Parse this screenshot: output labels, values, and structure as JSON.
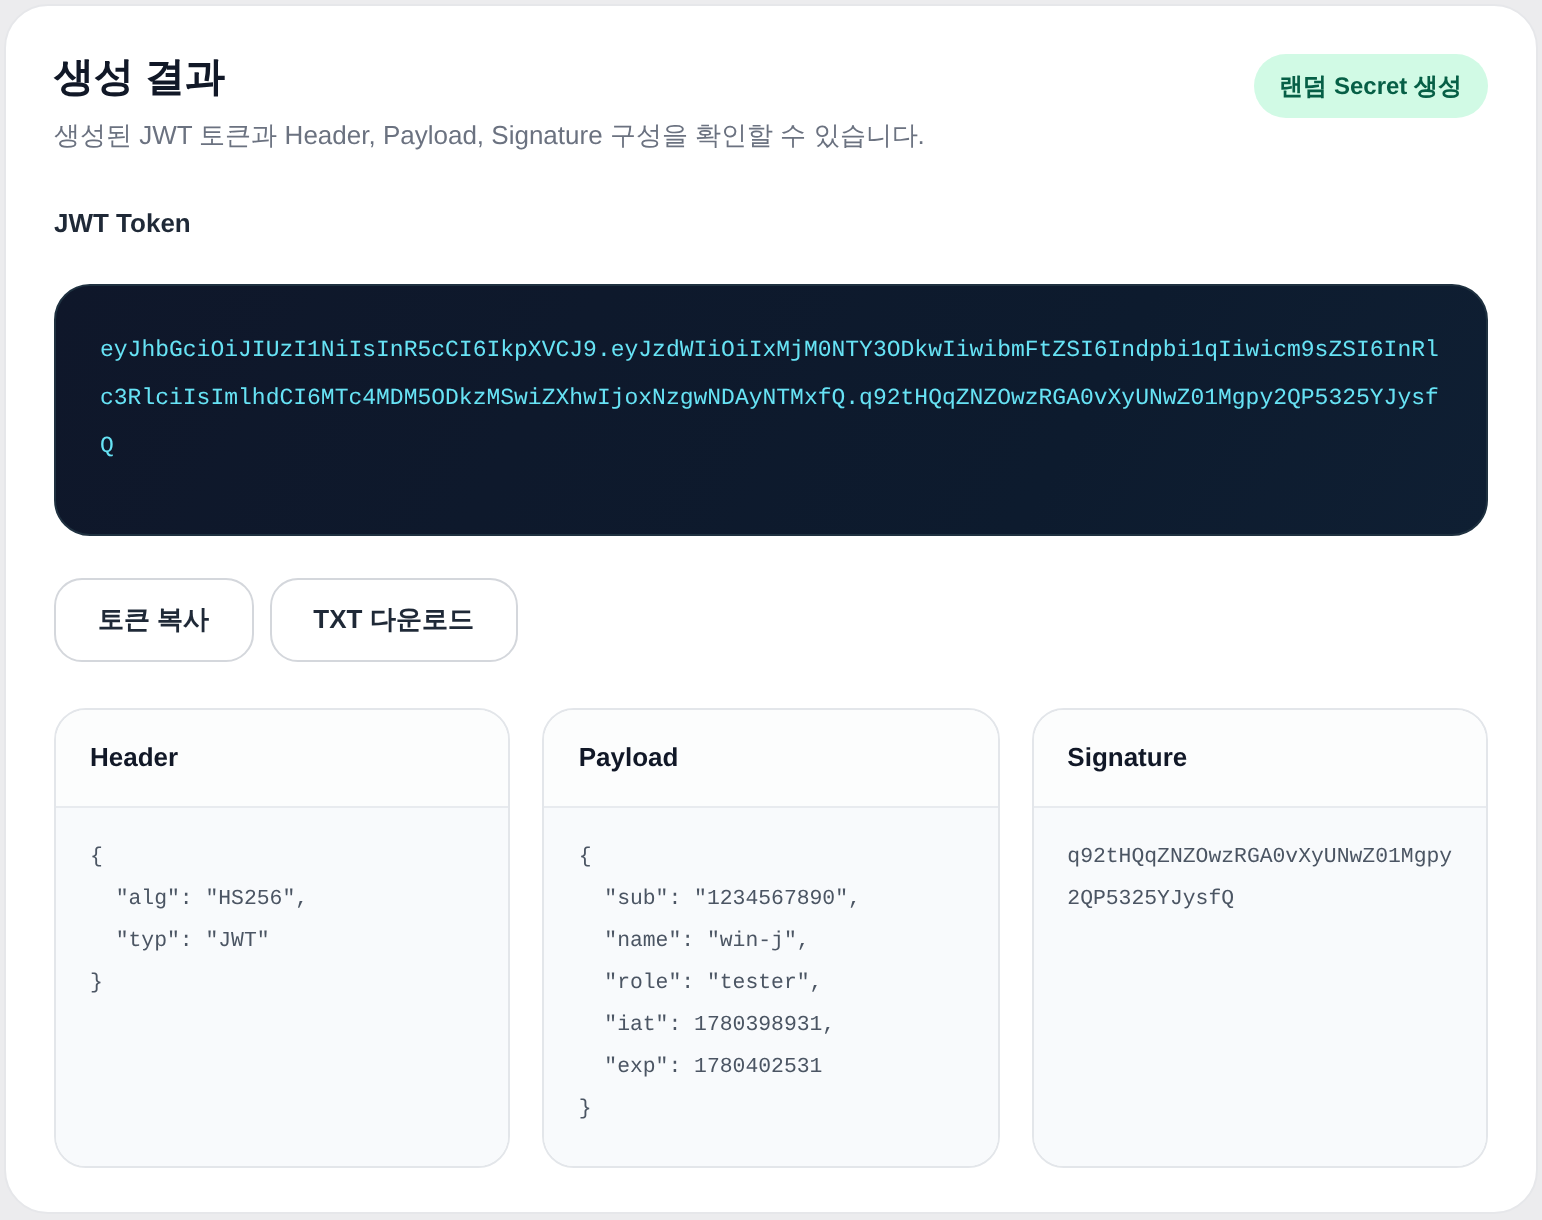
{
  "title": "생성 결과",
  "subtitle": "생성된 JWT 토큰과 Header, Payload, Signature 구성을 확인할 수 있습니다.",
  "action_button": "랜덤 Secret 생성",
  "token": {
    "label": "JWT Token",
    "value": "eyJhbGciOiJIUzI1NiIsInR5cCI6IkpXVCJ9.eyJzdWIiOiIxMjM0NTY3ODkwIiwibmFtZSI6Indpbi1qIiwicm9sZSI6InRlc3RlciIsImlhdCI6MTc4MDM5ODkzMSwiZXhwIjoxNzgwNDAyNTMxfQ.q92tHQqZNZOwzRGA0vXyUNwZ01Mgpy2QP5325YJysfQ"
  },
  "buttons": [
    "토큰 복사",
    "TXT 다운로드"
  ],
  "sections": [
    {
      "title": "Header",
      "content": "{\n  \"alg\": \"HS256\",\n  \"typ\": \"JWT\"\n}"
    },
    {
      "title": "Payload",
      "content": "{\n  \"sub\": \"1234567890\",\n  \"name\": \"win-j\",\n  \"role\": \"tester\",\n  \"iat\": 1780398931,\n  \"exp\": 1780402531\n}"
    },
    {
      "title": "Signature",
      "content": "q92tHQqZNZOwzRGA0vXyUNwZ01Mgpy2QP5325YJysfQ"
    }
  ]
}
